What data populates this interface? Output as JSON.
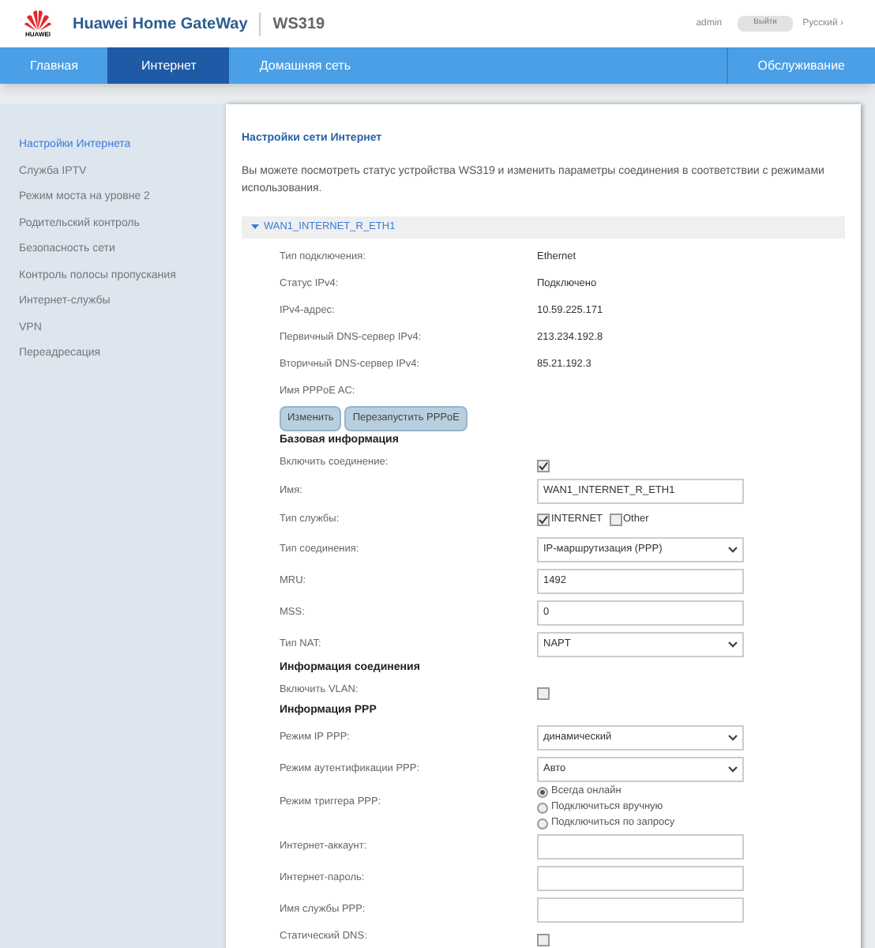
{
  "header": {
    "logo_text": "HUAWEI",
    "title": "Huawei Home GateWay",
    "model": "WS319",
    "user": "admin",
    "logout_button": "Выйти",
    "language": "Русский ›"
  },
  "nav": {
    "tabs": [
      {
        "label": "Главная",
        "selected": false
      },
      {
        "label": "Интернет",
        "selected": true
      },
      {
        "label": "Домашняя сеть",
        "selected": false
      },
      {
        "label": "Обслуживание",
        "selected": false
      }
    ]
  },
  "sidebar": {
    "items": [
      {
        "label": "Настройки Интернета",
        "selected": true
      },
      {
        "label": "Служба IPTV",
        "selected": false
      },
      {
        "label": "Режим моста на уровне 2",
        "selected": false
      },
      {
        "label": "Родительский контроль",
        "selected": false
      },
      {
        "label": "Безопасность сети",
        "selected": false
      },
      {
        "label": "Контроль полосы пропускания",
        "selected": false
      },
      {
        "label": "Интернет-службы",
        "selected": false
      },
      {
        "label": "VPN",
        "selected": false
      },
      {
        "label": "Переадресация",
        "selected": false
      }
    ]
  },
  "content": {
    "title": "Настройки сети Интернет",
    "description": "Вы можете посмотреть статус устройства WS319 и изменить параметры соединения в соответствии с режимами использования.",
    "section": {
      "title": "WAN1_INTERNET_R_ETH1",
      "expanded": true
    },
    "rows": [
      {
        "kind": "info",
        "label": "Тип подключения:",
        "value": "Ethernet"
      },
      {
        "kind": "info",
        "label": "Статус IPv4:",
        "value": "Подключено"
      },
      {
        "kind": "info",
        "label": "IPv4-адрес:",
        "value": "10.59.225.171"
      },
      {
        "kind": "info",
        "label": "Первичный DNS-сервер IPv4:",
        "value": "213.234.192.8"
      },
      {
        "kind": "info",
        "label": "Вторичный DNS-сервер IPv4:",
        "value": "85.21.192.3"
      },
      {
        "kind": "info",
        "label": "Имя PPPoE AC:"
      },
      {
        "kind": "buttons",
        "buttons": [
          "Изменить",
          "Перезапустить PPPoE"
        ]
      },
      {
        "kind": "heading",
        "label": "Базовая информация"
      },
      {
        "kind": "checkbox",
        "label": "Включить соединение:",
        "checked": true
      },
      {
        "kind": "input",
        "label": "Имя:",
        "value": "WAN1_INTERNET_R_ETH1"
      },
      {
        "kind": "services",
        "label": "Тип службы:",
        "options": [
          {
            "label": "INTERNET",
            "checked": true
          },
          {
            "label": "Other",
            "checked": false
          }
        ]
      },
      {
        "kind": "select",
        "label": "Тип соединения:",
        "value": "IP-маршрутизация (PPP)"
      },
      {
        "kind": "input",
        "label": "MRU:",
        "value": "1492"
      },
      {
        "kind": "input",
        "label": "MSS:",
        "value": "0"
      },
      {
        "kind": "select",
        "label": "Тип NAT:",
        "value": "NAPT"
      },
      {
        "kind": "heading",
        "label": "Информация соединения"
      },
      {
        "kind": "checkbox",
        "label": "Включить VLAN:",
        "checked": false
      },
      {
        "kind": "heading",
        "label": "Информация PPP"
      },
      {
        "kind": "select",
        "label": "Режим IP PPP:",
        "value": "динамический"
      },
      {
        "kind": "select",
        "label": "Режим аутентификации PPP:",
        "value": "Авто"
      },
      {
        "kind": "radios",
        "label": "Режим триггера PPP:",
        "options": [
          {
            "label": "Всегда онлайн",
            "selected": true
          },
          {
            "label": "Подключиться вручную",
            "selected": false
          },
          {
            "label": "Подключиться по запросу",
            "selected": false
          }
        ]
      },
      {
        "kind": "input",
        "label": "Интернет-аккаунт:"
      },
      {
        "kind": "input",
        "label": "Интернет-пароль:"
      },
      {
        "kind": "input",
        "label": "Имя службы PPP:"
      },
      {
        "kind": "checkbox",
        "label": "Статический DNS:",
        "checked": false
      }
    ]
  }
}
